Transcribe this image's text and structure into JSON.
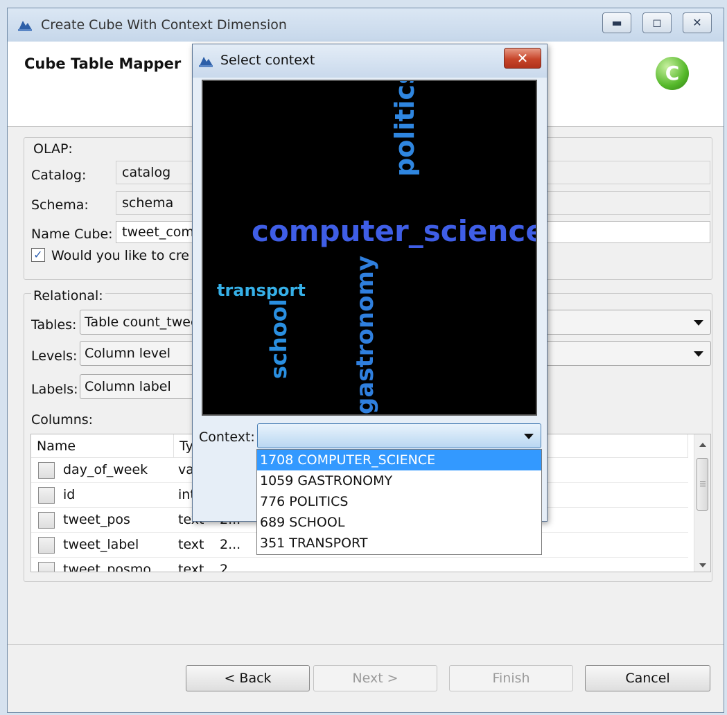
{
  "window": {
    "title": "Create Cube With Context Dimension",
    "controls": [
      "minimize",
      "maximize",
      "close"
    ]
  },
  "header": {
    "title": "Cube Table Mapper",
    "logo_letter": "C"
  },
  "olap": {
    "group_label": "OLAP:",
    "catalog_label": "Catalog:",
    "catalog_value": "catalog",
    "schema_label": "Schema:",
    "schema_value": "schema",
    "name_cube_label": "Name Cube:",
    "name_cube_value": "tweet_com",
    "checkbox_label": "Would you like to cre",
    "checkbox_checked": true
  },
  "relational": {
    "group_label": "Relational:",
    "tables_label": "Tables:",
    "tables_value": "Table count_twee",
    "levels_label": "Levels:",
    "levels_value": "Column level",
    "labels_label": "Labels:",
    "labels_value": "Column label",
    "columns_label": "Columns:"
  },
  "columns_table": {
    "headers": [
      "Name",
      "Ty"
    ],
    "rows": [
      {
        "name": "day_of_week",
        "type": "va",
        "extra": ""
      },
      {
        "name": "id",
        "type": "int",
        "extra": ""
      },
      {
        "name": "tweet_pos",
        "type": "text",
        "extra": "2..."
      },
      {
        "name": "tweet_label",
        "type": "text",
        "extra": "2..."
      },
      {
        "name": "tweet_posmo",
        "type": "text",
        "extra": "2"
      }
    ]
  },
  "buttons": {
    "back": "< Back",
    "next": "Next >",
    "finish": "Finish",
    "cancel": "Cancel"
  },
  "dialog": {
    "title": "Select context",
    "close_glyph": "✕",
    "word_cloud": [
      {
        "word": "politics",
        "color": "#2f86e0"
      },
      {
        "word": "computer_science",
        "color": "#3f5ee6"
      },
      {
        "word": "transport",
        "color": "#36b0e8"
      },
      {
        "word": "school",
        "color": "#2a8fe0"
      },
      {
        "word": "gastronomy",
        "color": "#2f7fde"
      }
    ],
    "context_label": "Context:",
    "context_value": "",
    "context_options": [
      "1708 COMPUTER_SCIENCE",
      "1059 GASTRONOMY",
      "776 POLITICS",
      "689 SCHOOL",
      "351 TRANSPORT"
    ],
    "selected_option": "1708 COMPUTER_SCIENCE"
  }
}
